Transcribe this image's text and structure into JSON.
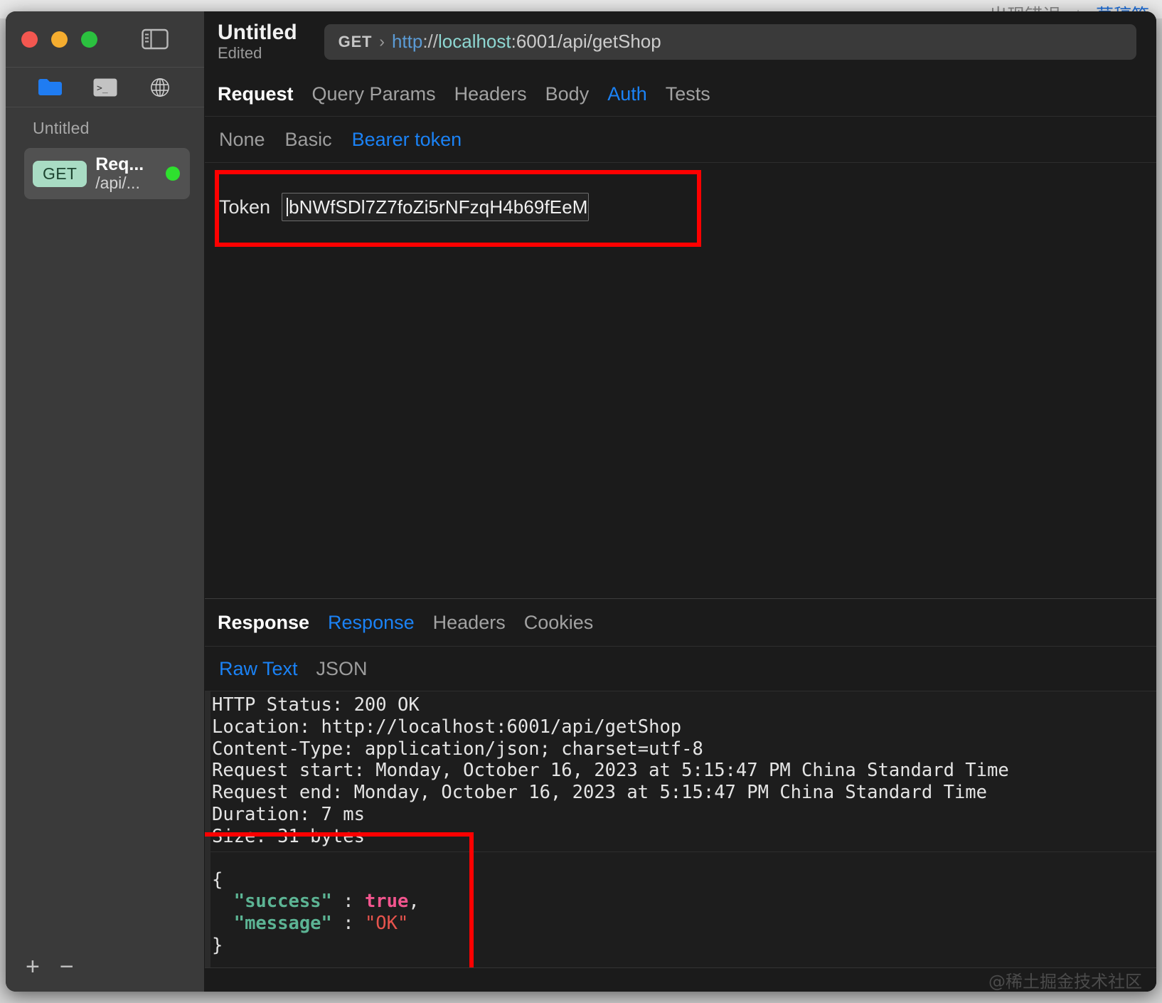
{
  "backdrop": {
    "tab_error_text": "出现错误",
    "separator": "|",
    "draft_text": "草稿箱"
  },
  "sidebar": {
    "toggle_icon": "sidebar-toggle-icon",
    "toolbar_icons": [
      "folder-icon",
      "terminal-icon",
      "globe-icon"
    ],
    "section_title": "Untitled",
    "request": {
      "method": "GET",
      "name": "Req...",
      "path": "/api/...",
      "status_color": "#2ee02e"
    },
    "footer": {
      "add_label": "+",
      "remove_label": "−"
    }
  },
  "header": {
    "title": "Untitled",
    "subtitle": "Edited",
    "url": {
      "method": "GET",
      "chevron": "›",
      "scheme": "http",
      "separator": "://",
      "host": "localhost",
      "rest": ":6001/api/getShop",
      "full": "http://localhost:6001/api/getShop"
    }
  },
  "request_tabs": [
    {
      "label": "Request",
      "state": "primary"
    },
    {
      "label": "Query Params",
      "state": "normal"
    },
    {
      "label": "Headers",
      "state": "normal"
    },
    {
      "label": "Body",
      "state": "normal"
    },
    {
      "label": "Auth",
      "state": "active"
    },
    {
      "label": "Tests",
      "state": "normal"
    }
  ],
  "auth": {
    "subtabs": [
      {
        "label": "None",
        "state": "normal"
      },
      {
        "label": "Basic",
        "state": "normal"
      },
      {
        "label": "Bearer token",
        "state": "active"
      }
    ],
    "token_label": "Token",
    "token_value": "bNWfSDl7Z7foZi5rNFzqH4b69fEeM"
  },
  "response_tabs": [
    {
      "label": "Response",
      "state": "primary"
    },
    {
      "label": "Response",
      "state": "active"
    },
    {
      "label": "Headers",
      "state": "normal"
    },
    {
      "label": "Cookies",
      "state": "normal"
    }
  ],
  "response_format_tabs": [
    {
      "label": "Raw Text",
      "state": "active"
    },
    {
      "label": "JSON",
      "state": "normal"
    }
  ],
  "response_meta": {
    "lines": [
      "HTTP Status: 200 OK",
      "Location: http://localhost:6001/api/getShop",
      "Content-Type: application/json; charset=utf-8",
      "Request start: Monday, October 16, 2023 at 5:15:47 PM China Standard Time",
      "Request end: Monday, October 16, 2023 at 5:15:47 PM China Standard Time",
      "Duration: 7 ms",
      "Size: 31 bytes"
    ],
    "status": "200 OK",
    "location": "http://localhost:6001/api/getShop",
    "content_type": "application/json; charset=utf-8",
    "request_start": "Monday, October 16, 2023 at 5:15:47 PM China Standard Time",
    "request_end": "Monday, October 16, 2023 at 5:15:47 PM China Standard Time",
    "duration": "7 ms",
    "size": "31 bytes"
  },
  "response_json": {
    "open_brace": "{",
    "close_brace": "}",
    "entries": [
      {
        "key": "\"success\"",
        "colon": " : ",
        "value": "true",
        "type": "bool",
        "comma": ","
      },
      {
        "key": "\"message\"",
        "colon": " : ",
        "value": "\"OK\"",
        "type": "string",
        "comma": ""
      }
    ]
  },
  "annotations": {
    "token_box_color": "#fe0000",
    "json_box_color": "#fe0000"
  },
  "watermark": "@稀土掘金技术社区"
}
